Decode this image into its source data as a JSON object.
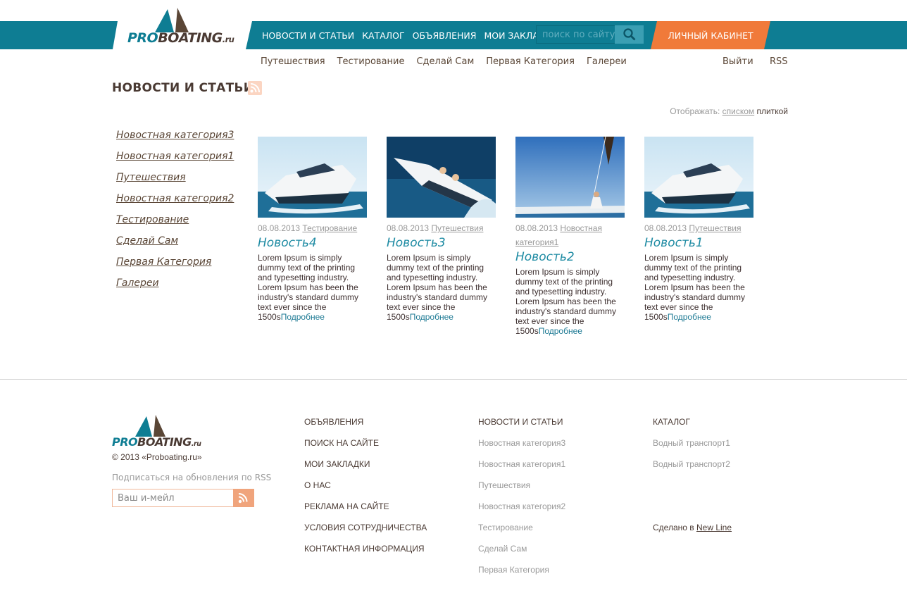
{
  "header": {
    "logo": {
      "pro": "PRO",
      "boating": "BOATING",
      "ru": ".ru"
    },
    "nav": [
      "НОВОСТИ И СТАТЬИ",
      "КАТАЛОГ",
      "ОБЪЯВЛЕНИЯ",
      "МОИ ЗАКЛАДКИ"
    ],
    "search_placeholder": "поиск по сайту",
    "cabinet_label": "ЛИЧНЫЙ КАБИНЕТ",
    "colors": {
      "bar": "#0e7d93",
      "accent": "#f07a3a"
    }
  },
  "subnav": {
    "items": [
      "Путешествия",
      "Тестирование",
      "Сделай Сам",
      "Первая Категория",
      "Галереи"
    ],
    "logout": "Выйти",
    "rss": "RSS"
  },
  "page": {
    "title": "НОВОСТИ И СТАТЬИ",
    "display_label": "Отображать:",
    "display_list": "списком",
    "display_tile": "плиткой"
  },
  "sidebar": {
    "items": [
      "Новостная категория3",
      "Новостная категория1",
      "Путешествия",
      "Новостная категория2",
      "Тестирование",
      "Сделай Сам",
      "Первая Категория",
      "Галереи"
    ]
  },
  "news": [
    {
      "date": "08.08.2013",
      "category": "Тестирование",
      "title": "Новость4",
      "excerpt": "Lorem Ipsum is simply dummy text of the printing and typesetting industry. Lorem Ipsum has been the industry's standard dummy text ever since the 1500s",
      "more": "Подробнее"
    },
    {
      "date": "08.08.2013",
      "category": "Путешествия",
      "title": "Новость3",
      "excerpt": "Lorem Ipsum is simply dummy text of the printing and typesetting industry. Lorem Ipsum has been the industry's standard dummy text ever since the 1500s",
      "more": "Подробнее"
    },
    {
      "date": "08.08.2013",
      "category": "Новостная категория1",
      "title": "Новость2",
      "excerpt": "Lorem Ipsum is simply dummy text of the printing and typesetting industry. Lorem Ipsum has been the industry's standard dummy text ever since the 1500s",
      "more": "Подробнее"
    },
    {
      "date": "08.08.2013",
      "category": "Путешествия",
      "title": "Новость1",
      "excerpt": "Lorem Ipsum is simply dummy text of the printing and typesetting industry. Lorem Ipsum has been the industry's standard dummy text ever since the 1500s",
      "more": "Подробнее"
    }
  ],
  "footer": {
    "copyright": "© 2013 «Proboating.ru»",
    "subscribe_label": "Подписаться на обновления по RSS",
    "email_placeholder": "Ваш и-мейл",
    "col1": [
      "ОБЪЯВЛЕНИЯ",
      "ПОИСК НА САЙТЕ",
      "МОИ ЗАКЛАДКИ",
      "О НАС",
      "РЕКЛАМА НА САЙТЕ",
      "УСЛОВИЯ СОТРУДНИЧЕСТВА",
      "КОНТАКТНАЯ ИНФОРМАЦИЯ"
    ],
    "col2_head": "НОВОСТИ И СТАТЬИ",
    "col2": [
      "Новостная категория3",
      "Новостная категория1",
      "Путешествия",
      "Новостная категория2",
      "Тестирование",
      "Сделай Сам",
      "Первая Категория"
    ],
    "col3_head": "КАТАЛОГ",
    "col3": [
      "Водный транспорт1",
      "Водный транспорт2"
    ],
    "made_by": "Сделано в",
    "made_link": "New Line"
  }
}
